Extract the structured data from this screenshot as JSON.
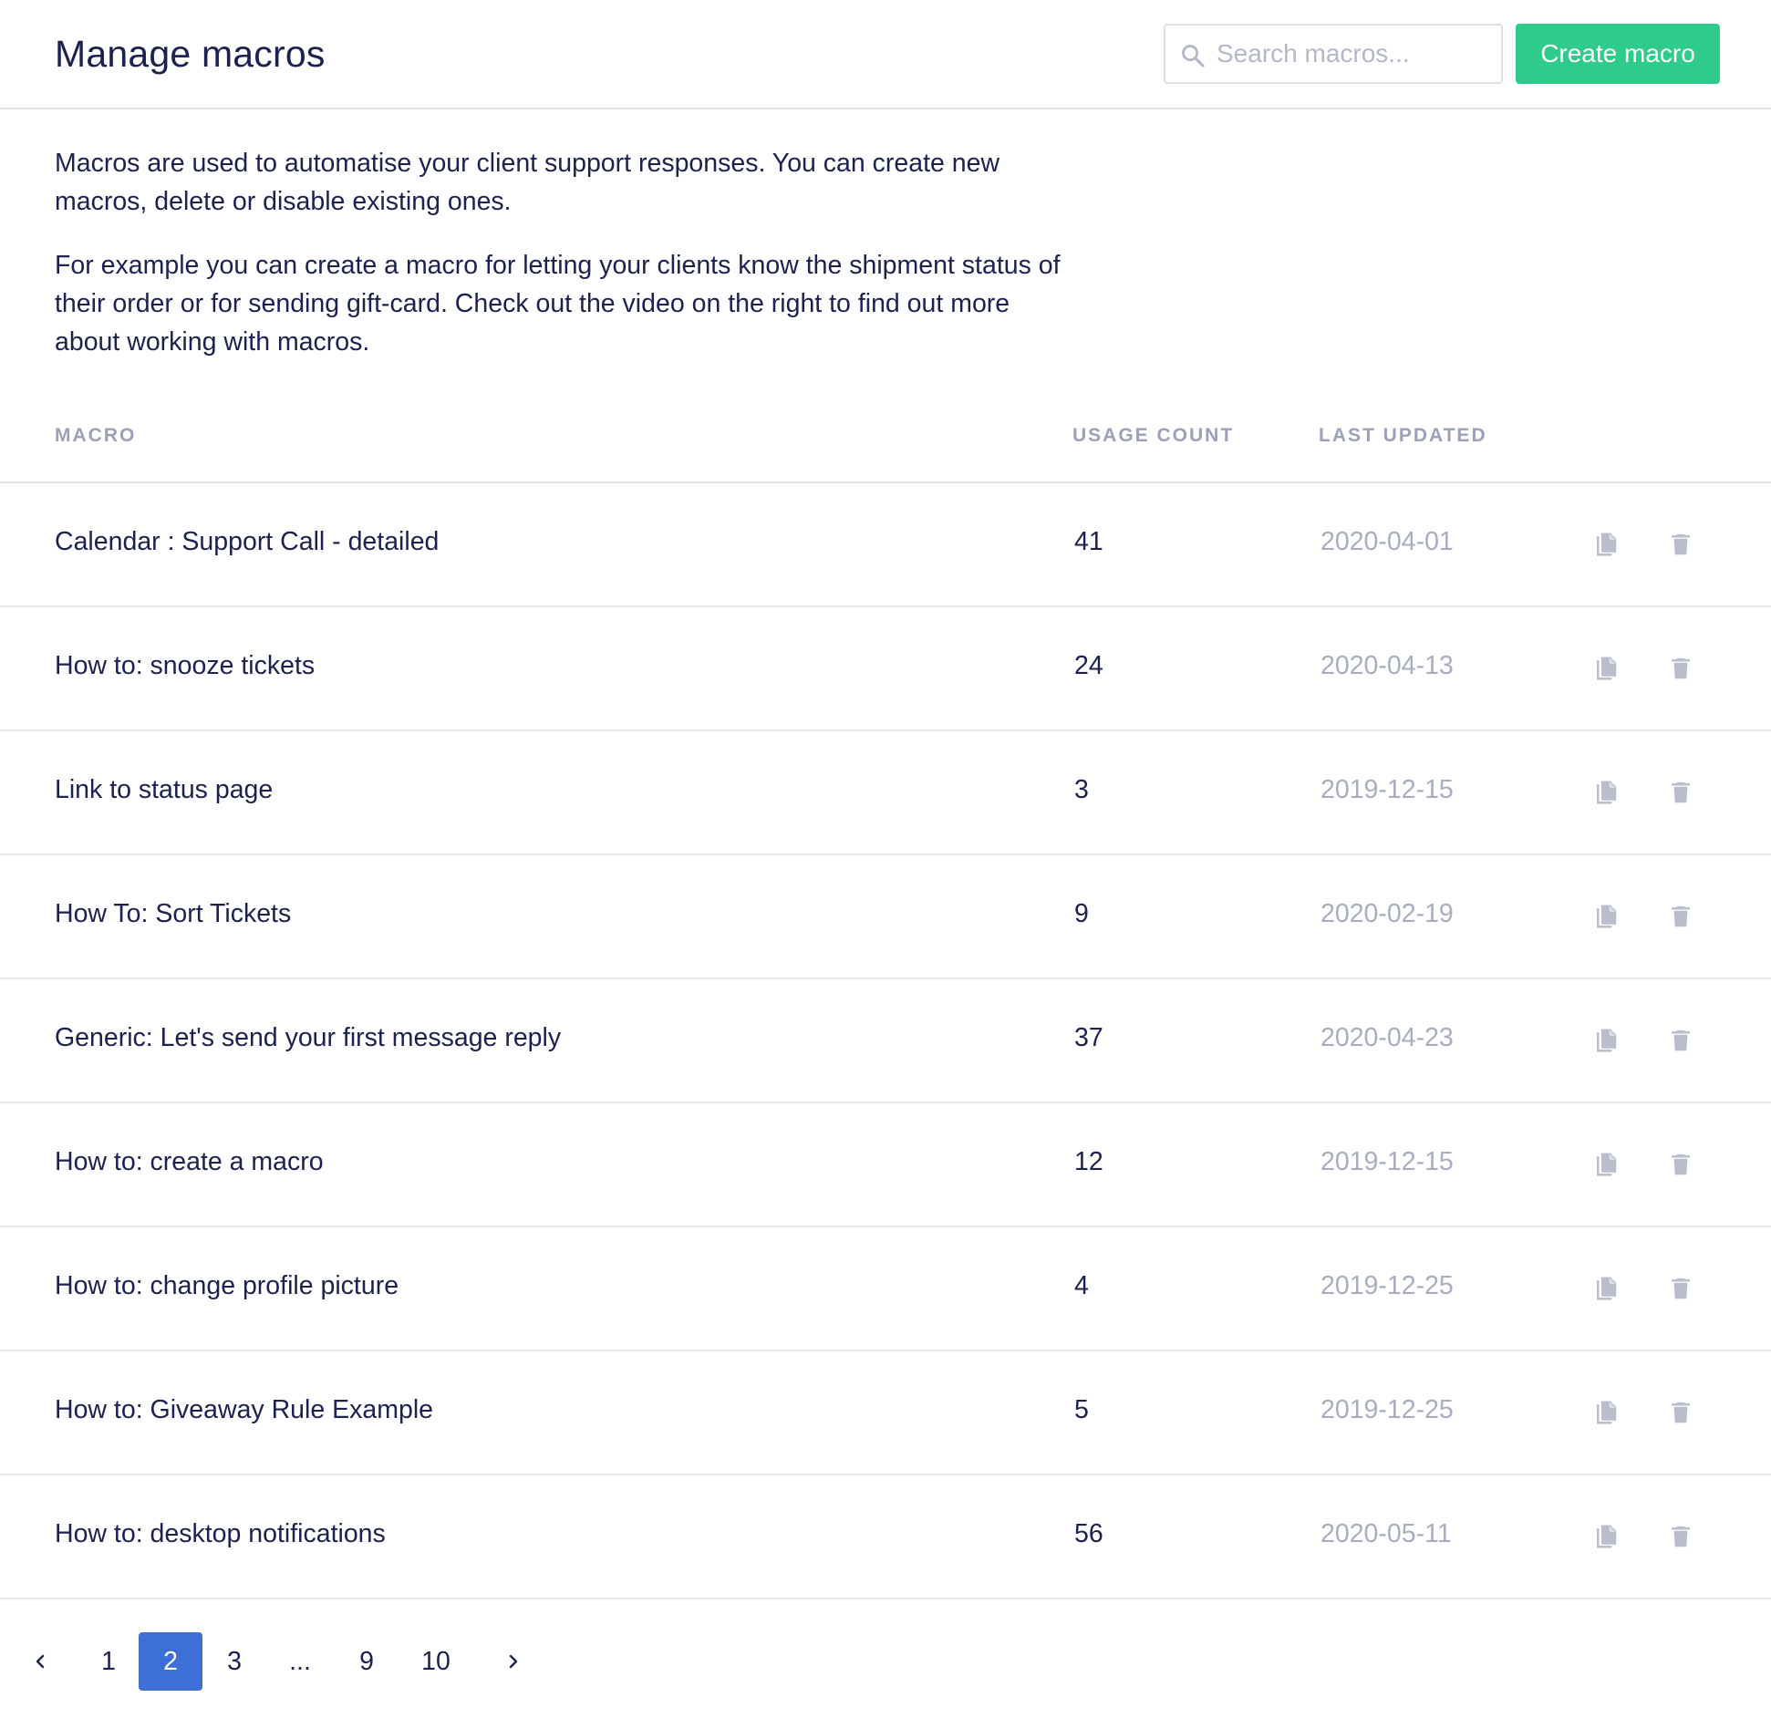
{
  "header": {
    "title": "Manage macros",
    "search_placeholder": "Search macros...",
    "create_button": "Create macro"
  },
  "intro": {
    "paragraph_1": "Macros are used to automatise your client support responses. You can create new macros, delete or disable existing ones.",
    "paragraph_2": "For example you can create a macro for letting your clients know the shipment status of their order or for sending gift-card. Check out the video on the right to find out more about working with macros."
  },
  "table": {
    "columns": {
      "macro": "MACRO",
      "usage_count": "USAGE COUNT",
      "last_updated": "LAST UPDATED"
    },
    "rows": [
      {
        "name": "Calendar : Support Call - detailed",
        "count": "41",
        "updated": "2020-04-01"
      },
      {
        "name": "How to: snooze tickets",
        "count": "24",
        "updated": "2020-04-13"
      },
      {
        "name": "Link to status page",
        "count": "3",
        "updated": "2019-12-15"
      },
      {
        "name": "How To: Sort Tickets",
        "count": "9",
        "updated": "2020-02-19"
      },
      {
        "name": "Generic: Let's send your first message reply",
        "count": "37",
        "updated": "2020-04-23"
      },
      {
        "name": "How to: create a macro",
        "count": "12",
        "updated": "2019-12-15"
      },
      {
        "name": "How to: change profile picture",
        "count": "4",
        "updated": "2019-12-25"
      },
      {
        "name": "How to: Giveaway Rule Example",
        "count": "5",
        "updated": "2019-12-25"
      },
      {
        "name": "How to: desktop notifications",
        "count": "56",
        "updated": "2020-05-11"
      }
    ],
    "row_icons": [
      "duplicate-icon",
      "trash-icon"
    ]
  },
  "pagination": {
    "pages": [
      "1",
      "2",
      "3",
      "...",
      "9",
      "10"
    ],
    "current": "2",
    "prev_icon": "chevron-left-icon",
    "next_icon": "chevron-right-icon"
  },
  "colors": {
    "accent_green": "#2fcb8b",
    "active_page_blue": "#3d6fd6",
    "text_primary": "#1c2152",
    "text_muted": "#a8aec2"
  }
}
